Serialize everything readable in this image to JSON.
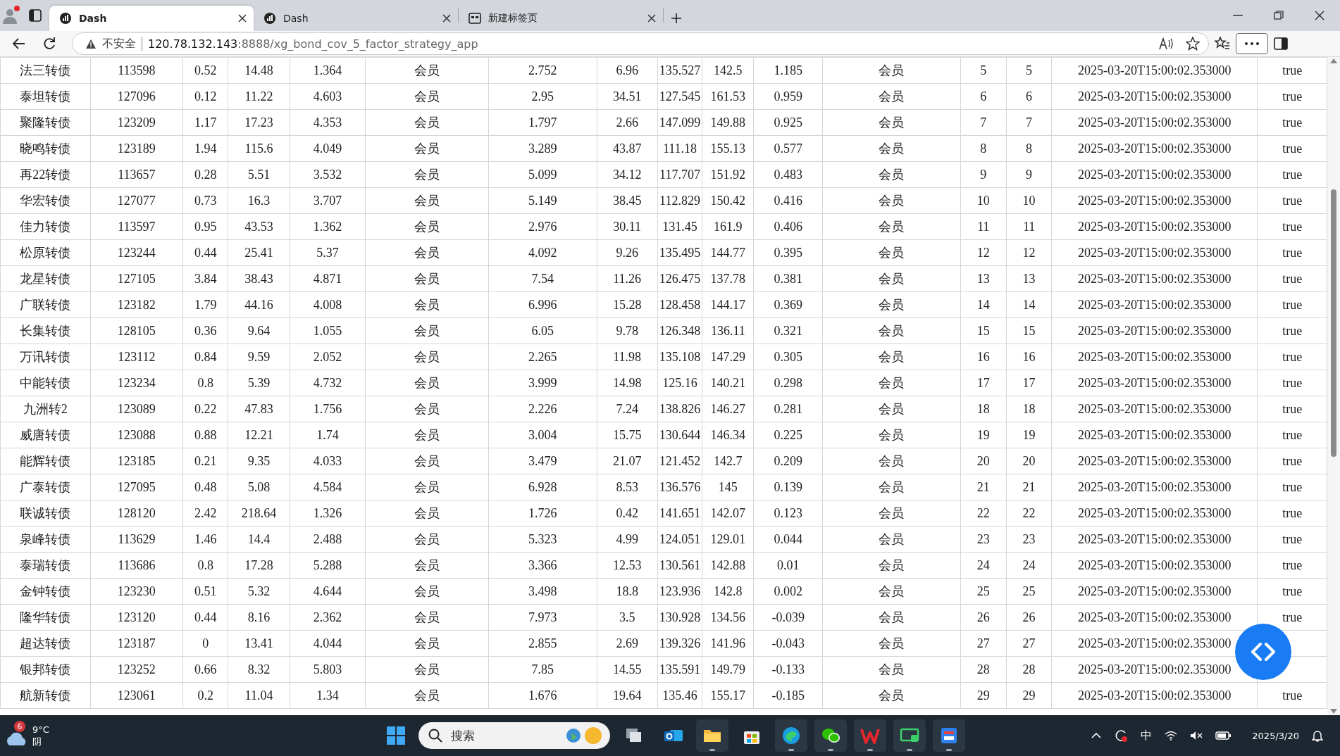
{
  "browser": {
    "tabs": [
      {
        "title": "Dash",
        "kind": "dash",
        "selected": true
      },
      {
        "title": "Dash",
        "kind": "dash",
        "selected": false
      },
      {
        "title": "新建标签页",
        "kind": "newtab",
        "selected": false
      }
    ],
    "address": {
      "security": "不安全",
      "host": "120.78.132.143",
      "path": ":8888/xg_bond_cov_5_factor_strategy_app"
    }
  },
  "table": {
    "rows": [
      [
        "法三转债",
        "113598",
        "0.52",
        "14.48",
        "1.364",
        "会员",
        "2.752",
        "6.96",
        "135.527",
        "142.5",
        "1.185",
        "会员",
        "5",
        "5",
        "2025-03-20T15:00:02.353000",
        "true"
      ],
      [
        "泰坦转债",
        "127096",
        "0.12",
        "11.22",
        "4.603",
        "会员",
        "2.95",
        "34.51",
        "127.545",
        "161.53",
        "0.959",
        "会员",
        "6",
        "6",
        "2025-03-20T15:00:02.353000",
        "true"
      ],
      [
        "聚隆转债",
        "123209",
        "1.17",
        "17.23",
        "4.353",
        "会员",
        "1.797",
        "2.66",
        "147.099",
        "149.88",
        "0.925",
        "会员",
        "7",
        "7",
        "2025-03-20T15:00:02.353000",
        "true"
      ],
      [
        "晓鸣转债",
        "123189",
        "1.94",
        "115.6",
        "4.049",
        "会员",
        "3.289",
        "43.87",
        "111.18",
        "155.13",
        "0.577",
        "会员",
        "8",
        "8",
        "2025-03-20T15:00:02.353000",
        "true"
      ],
      [
        "再22转债",
        "113657",
        "0.28",
        "5.51",
        "3.532",
        "会员",
        "5.099",
        "34.12",
        "117.707",
        "151.92",
        "0.483",
        "会员",
        "9",
        "9",
        "2025-03-20T15:00:02.353000",
        "true"
      ],
      [
        "华宏转债",
        "127077",
        "0.73",
        "16.3",
        "3.707",
        "会员",
        "5.149",
        "38.45",
        "112.829",
        "150.42",
        "0.416",
        "会员",
        "10",
        "10",
        "2025-03-20T15:00:02.353000",
        "true"
      ],
      [
        "佳力转债",
        "113597",
        "0.95",
        "43.53",
        "1.362",
        "会员",
        "2.976",
        "30.11",
        "131.45",
        "161.9",
        "0.406",
        "会员",
        "11",
        "11",
        "2025-03-20T15:00:02.353000",
        "true"
      ],
      [
        "松原转债",
        "123244",
        "0.44",
        "25.41",
        "5.37",
        "会员",
        "4.092",
        "9.26",
        "135.495",
        "144.77",
        "0.395",
        "会员",
        "12",
        "12",
        "2025-03-20T15:00:02.353000",
        "true"
      ],
      [
        "龙星转债",
        "127105",
        "3.84",
        "38.43",
        "4.871",
        "会员",
        "7.54",
        "11.26",
        "126.475",
        "137.78",
        "0.381",
        "会员",
        "13",
        "13",
        "2025-03-20T15:00:02.353000",
        "true"
      ],
      [
        "广联转债",
        "123182",
        "1.79",
        "44.16",
        "4.008",
        "会员",
        "6.996",
        "15.28",
        "128.458",
        "144.17",
        "0.369",
        "会员",
        "14",
        "14",
        "2025-03-20T15:00:02.353000",
        "true"
      ],
      [
        "长集转债",
        "128105",
        "0.36",
        "9.64",
        "1.055",
        "会员",
        "6.05",
        "9.78",
        "126.348",
        "136.11",
        "0.321",
        "会员",
        "15",
        "15",
        "2025-03-20T15:00:02.353000",
        "true"
      ],
      [
        "万讯转债",
        "123112",
        "0.84",
        "9.59",
        "2.052",
        "会员",
        "2.265",
        "11.98",
        "135.108",
        "147.29",
        "0.305",
        "会员",
        "16",
        "16",
        "2025-03-20T15:00:02.353000",
        "true"
      ],
      [
        "中能转债",
        "123234",
        "0.8",
        "5.39",
        "4.732",
        "会员",
        "3.999",
        "14.98",
        "125.16",
        "140.21",
        "0.298",
        "会员",
        "17",
        "17",
        "2025-03-20T15:00:02.353000",
        "true"
      ],
      [
        "九洲转2",
        "123089",
        "0.22",
        "47.83",
        "1.756",
        "会员",
        "2.226",
        "7.24",
        "138.826",
        "146.27",
        "0.281",
        "会员",
        "18",
        "18",
        "2025-03-20T15:00:02.353000",
        "true"
      ],
      [
        "威唐转债",
        "123088",
        "0.88",
        "12.21",
        "1.74",
        "会员",
        "3.004",
        "15.75",
        "130.644",
        "146.34",
        "0.225",
        "会员",
        "19",
        "19",
        "2025-03-20T15:00:02.353000",
        "true"
      ],
      [
        "能辉转债",
        "123185",
        "0.21",
        "9.35",
        "4.033",
        "会员",
        "3.479",
        "21.07",
        "121.452",
        "142.7",
        "0.209",
        "会员",
        "20",
        "20",
        "2025-03-20T15:00:02.353000",
        "true"
      ],
      [
        "广泰转债",
        "127095",
        "0.48",
        "5.08",
        "4.584",
        "会员",
        "6.928",
        "8.53",
        "136.576",
        "145",
        "0.139",
        "会员",
        "21",
        "21",
        "2025-03-20T15:00:02.353000",
        "true"
      ],
      [
        "联诚转债",
        "128120",
        "2.42",
        "218.64",
        "1.326",
        "会员",
        "1.726",
        "0.42",
        "141.651",
        "142.07",
        "0.123",
        "会员",
        "22",
        "22",
        "2025-03-20T15:00:02.353000",
        "true"
      ],
      [
        "泉峰转债",
        "113629",
        "1.46",
        "14.4",
        "2.488",
        "会员",
        "5.323",
        "4.99",
        "124.051",
        "129.01",
        "0.044",
        "会员",
        "23",
        "23",
        "2025-03-20T15:00:02.353000",
        "true"
      ],
      [
        "泰瑞转债",
        "113686",
        "0.8",
        "17.28",
        "5.288",
        "会员",
        "3.366",
        "12.53",
        "130.561",
        "142.88",
        "0.01",
        "会员",
        "24",
        "24",
        "2025-03-20T15:00:02.353000",
        "true"
      ],
      [
        "金钟转债",
        "123230",
        "0.51",
        "5.32",
        "4.644",
        "会员",
        "3.498",
        "18.8",
        "123.936",
        "142.8",
        "0.002",
        "会员",
        "25",
        "25",
        "2025-03-20T15:00:02.353000",
        "true"
      ],
      [
        "隆华转债",
        "123120",
        "0.44",
        "8.16",
        "2.362",
        "会员",
        "7.973",
        "3.5",
        "130.928",
        "134.56",
        "-0.039",
        "会员",
        "26",
        "26",
        "2025-03-20T15:00:02.353000",
        "true"
      ],
      [
        "超达转债",
        "123187",
        "0",
        "13.41",
        "4.044",
        "会员",
        "2.855",
        "2.69",
        "139.326",
        "141.96",
        "-0.043",
        "会员",
        "27",
        "27",
        "2025-03-20T15:00:02.353000"
      ],
      [
        "银邦转债",
        "123252",
        "0.66",
        "8.32",
        "5.803",
        "会员",
        "7.85",
        "14.55",
        "135.591",
        "149.79",
        "-0.133",
        "会员",
        "28",
        "28",
        "2025-03-20T15:00:02.353000"
      ],
      [
        "航新转债",
        "123061",
        "0.2",
        "11.04",
        "1.34",
        "会员",
        "1.676",
        "19.64",
        "135.46",
        "155.17",
        "-0.185",
        "会员",
        "29",
        "29",
        "2025-03-20T15:00:02.353000",
        "true"
      ]
    ]
  },
  "taskbar": {
    "weather": {
      "badge": "6",
      "temperature": "9°C",
      "condition": "阴"
    },
    "search": {
      "placeholder": "搜索"
    },
    "apps": [
      {
        "kind": "taskview",
        "running": false
      },
      {
        "kind": "mail",
        "running": false
      },
      {
        "kind": "folder",
        "running": true
      },
      {
        "kind": "store",
        "running": false
      },
      {
        "kind": "browser",
        "running": true
      },
      {
        "kind": "chat",
        "running": true
      },
      {
        "kind": "office",
        "running": true
      },
      {
        "kind": "screen",
        "running": true
      },
      {
        "kind": "trade",
        "running": true
      }
    ],
    "ime": "中",
    "date": "2025/3/20"
  }
}
